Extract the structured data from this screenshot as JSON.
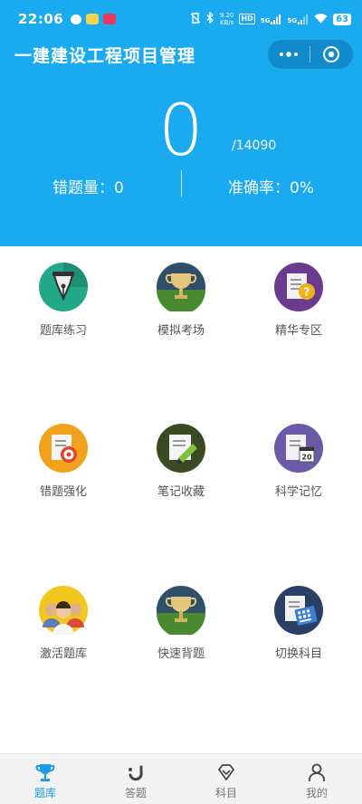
{
  "status_bar": {
    "time": "22:06",
    "net_speed_value": "9.20",
    "net_speed_unit": "KB/s",
    "sim1": "HD",
    "sim2": "5G",
    "sim3": "5G",
    "battery": "63"
  },
  "header": {
    "title": "一建建设工程项目管理",
    "count": "0",
    "total": "/14090",
    "wrong_label": "错题量：0",
    "accuracy_label": "准确率：0%"
  },
  "grid": [
    {
      "label": "题库练习",
      "icon": "pen-nib-icon"
    },
    {
      "label": "模拟考场",
      "icon": "trophy-icon"
    },
    {
      "label": "精华专区",
      "icon": "question-document-icon"
    },
    {
      "label": "错题强化",
      "icon": "document-target-icon"
    },
    {
      "label": "笔记收藏",
      "icon": "note-pencil-icon"
    },
    {
      "label": "科学记忆",
      "icon": "calendar-document-icon"
    },
    {
      "label": "激活题库",
      "icon": "people-group-icon"
    },
    {
      "label": "快速背题",
      "icon": "trophy-icon"
    },
    {
      "label": "切换科目",
      "icon": "keyboard-calendar-icon"
    }
  ],
  "tabs": [
    {
      "label": "题库",
      "icon": "trophy-icon",
      "active": true
    },
    {
      "label": "答题",
      "icon": "smile-icon",
      "active": false
    },
    {
      "label": "科目",
      "icon": "diamond-icon",
      "active": false
    },
    {
      "label": "我的",
      "icon": "person-icon",
      "active": false
    }
  ],
  "colors": {
    "primary": "#19aaf0",
    "tab_active": "#1a9be6",
    "label": "#555555"
  }
}
